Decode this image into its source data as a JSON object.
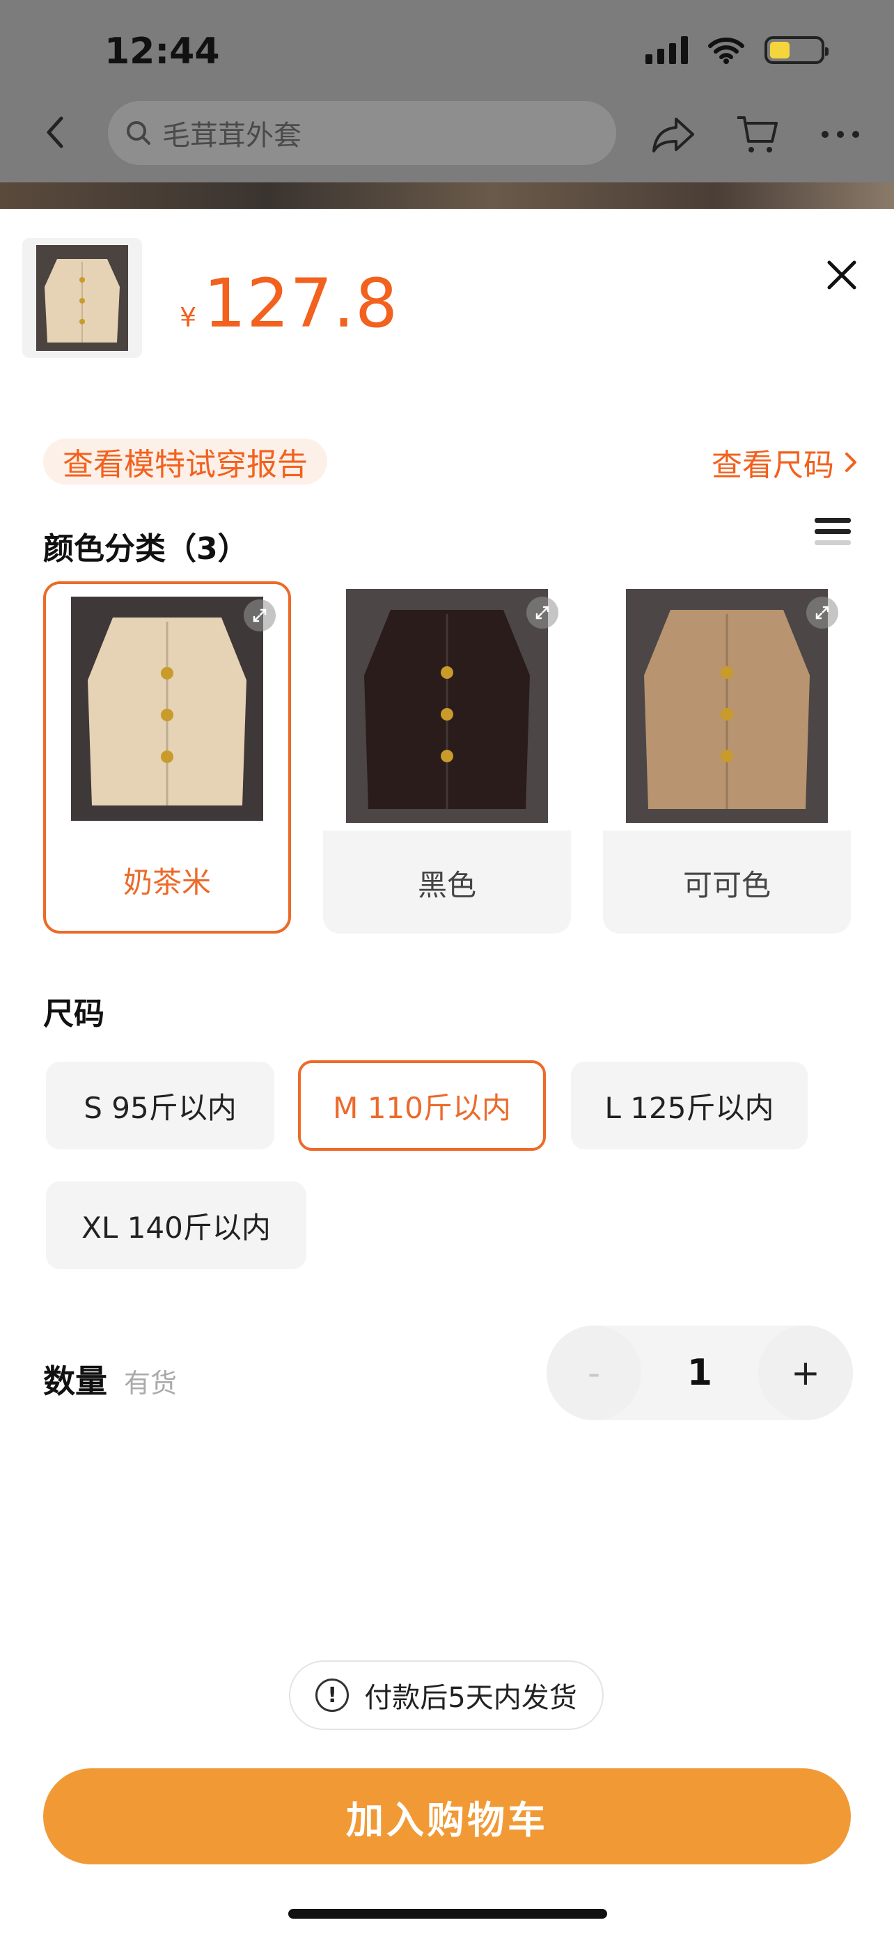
{
  "status_bar": {
    "time": "12:44"
  },
  "nav": {
    "search_placeholder": "毛茸茸外套"
  },
  "product": {
    "price_symbol": "¥",
    "price": "127.8"
  },
  "links": {
    "model_report": "查看模特试穿报告",
    "size_chart": "查看尺码"
  },
  "colors": {
    "title": "颜色分类（3）",
    "options": [
      {
        "label": "奶茶米",
        "selected": true,
        "swatch": "#e6d2b4"
      },
      {
        "label": "黑色",
        "selected": false,
        "swatch": "#2a1c1a"
      },
      {
        "label": "可可色",
        "selected": false,
        "swatch": "#b89470"
      }
    ]
  },
  "sizes": {
    "title": "尺码",
    "options": [
      {
        "label": "S 95斤以内",
        "selected": false
      },
      {
        "label": "M 110斤以内",
        "selected": true
      },
      {
        "label": "L 125斤以内",
        "selected": false
      },
      {
        "label": "XL 140斤以内",
        "selected": false
      }
    ]
  },
  "quantity": {
    "label": "数量",
    "stock": "有货",
    "minus": "-",
    "value": "1",
    "plus": "+"
  },
  "shipping_notice": {
    "icon_text": "!",
    "text": "付款后5天内发货"
  },
  "add_to_cart": "加入购物车",
  "accent_colors": {
    "price": "#f2611e",
    "selection": "#ec6a2a",
    "button": "#f19a35"
  }
}
